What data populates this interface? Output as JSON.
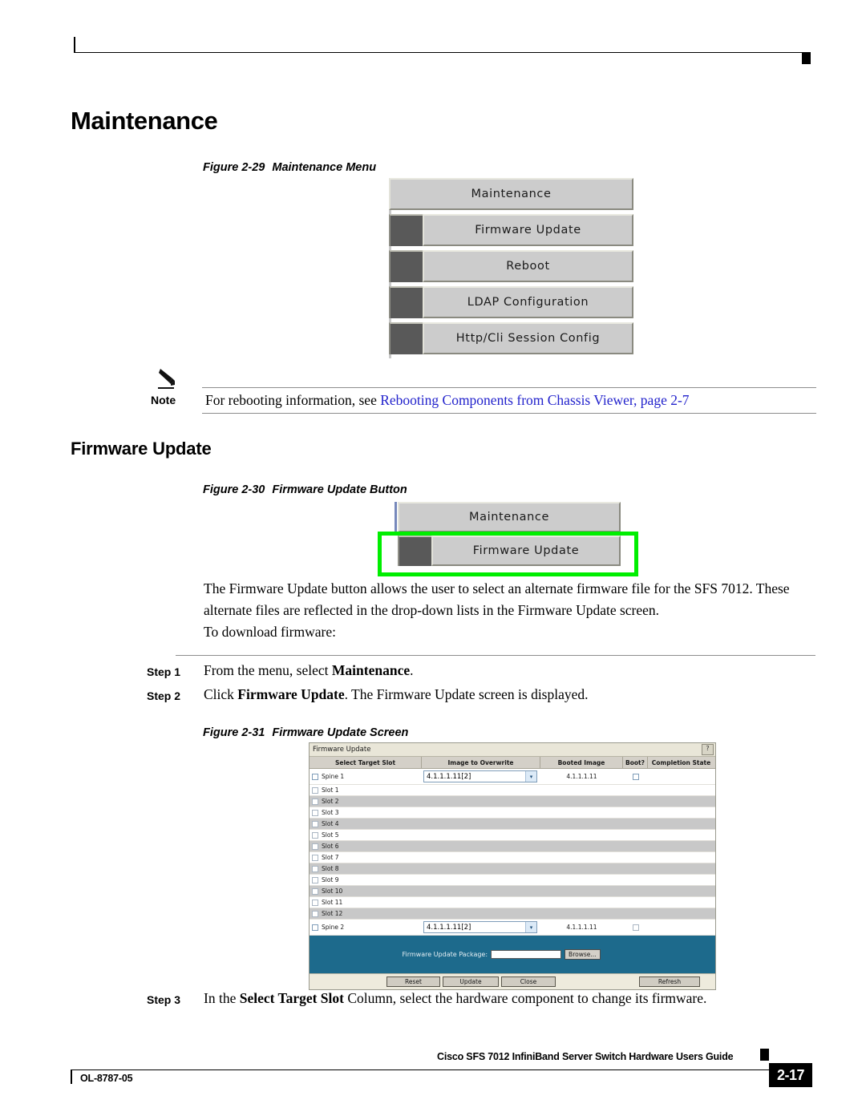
{
  "page": {
    "heading_maintenance": "Maintenance",
    "heading_firmware_update": "Firmware Update"
  },
  "figure_229": {
    "caption_number": "Figure 2-29",
    "caption_title": "Maintenance Menu",
    "menu_items": [
      {
        "label": "Maintenance",
        "has_gutter": false
      },
      {
        "label": "Firmware Update",
        "has_gutter": true
      },
      {
        "label": "Reboot",
        "has_gutter": true
      },
      {
        "label": "LDAP Configuration",
        "has_gutter": true
      },
      {
        "label": "Http/Cli Session Config",
        "has_gutter": true
      }
    ]
  },
  "note": {
    "label": "Note",
    "text_before": "For rebooting information, see ",
    "link_text": "Rebooting Components from Chassis Viewer, page 2-7",
    "link_color": "#2222cc"
  },
  "figure_230": {
    "caption_number": "Figure 2-30",
    "caption_title": "Firmware Update Button",
    "menu_items": [
      {
        "label": "Maintenance",
        "has_gutter": false
      },
      {
        "label": "Firmware Update",
        "has_gutter": true
      }
    ],
    "highlight_color": "#00ee00"
  },
  "body": {
    "paragraph_1": "The Firmware Update button allows the user to select an alternate firmware file for the SFS 7012. These alternate files are reflected in the drop-down lists in the Firmware Update screen.",
    "paragraph_2": "To download firmware:"
  },
  "steps": [
    {
      "label": "Step 1",
      "text_plain_1": "From the menu, select ",
      "text_bold": "Maintenance",
      "text_plain_2": "."
    },
    {
      "label": "Step 2",
      "text_plain_1": "Click ",
      "text_bold": "Firmware Update",
      "text_plain_2": ". The Firmware Update screen is displayed."
    },
    {
      "label": "Step 3",
      "text_plain_1": "In the ",
      "text_bold": "Select Target Slot",
      "text_plain_2": " Column, select the hardware component to change its firmware."
    }
  ],
  "figure_231": {
    "caption_number": "Figure 2-31",
    "caption_title": "Firmware Update Screen",
    "window_title": "Firmware Update",
    "help_button": "?",
    "columns": [
      "Select Target Slot",
      "Image to Overwrite",
      "Booted Image",
      "Boot?",
      "Completion State"
    ],
    "rows": [
      {
        "slot": "Spine 1",
        "image_to_overwrite": "4.1.1.1.11[2]",
        "booted_image": "4.1.1.1.11",
        "boot": false,
        "completion_state": "",
        "has_controls": true
      },
      {
        "slot": "Slot 1",
        "image_to_overwrite": "",
        "booted_image": "",
        "boot": null,
        "completion_state": "",
        "has_controls": false
      },
      {
        "slot": "Slot 2",
        "image_to_overwrite": "",
        "booted_image": "",
        "boot": null,
        "completion_state": "",
        "has_controls": false
      },
      {
        "slot": "Slot 3",
        "image_to_overwrite": "",
        "booted_image": "",
        "boot": null,
        "completion_state": "",
        "has_controls": false
      },
      {
        "slot": "Slot 4",
        "image_to_overwrite": "",
        "booted_image": "",
        "boot": null,
        "completion_state": "",
        "has_controls": false
      },
      {
        "slot": "Slot 5",
        "image_to_overwrite": "",
        "booted_image": "",
        "boot": null,
        "completion_state": "",
        "has_controls": false
      },
      {
        "slot": "Slot 6",
        "image_to_overwrite": "",
        "booted_image": "",
        "boot": null,
        "completion_state": "",
        "has_controls": false
      },
      {
        "slot": "Slot 7",
        "image_to_overwrite": "",
        "booted_image": "",
        "boot": null,
        "completion_state": "",
        "has_controls": false
      },
      {
        "slot": "Slot 8",
        "image_to_overwrite": "",
        "booted_image": "",
        "boot": null,
        "completion_state": "",
        "has_controls": false
      },
      {
        "slot": "Slot 9",
        "image_to_overwrite": "",
        "booted_image": "",
        "boot": null,
        "completion_state": "",
        "has_controls": false
      },
      {
        "slot": "Slot 10",
        "image_to_overwrite": "",
        "booted_image": "",
        "boot": null,
        "completion_state": "",
        "has_controls": false
      },
      {
        "slot": "Slot 11",
        "image_to_overwrite": "",
        "booted_image": "",
        "boot": null,
        "completion_state": "",
        "has_controls": false
      },
      {
        "slot": "Slot 12",
        "image_to_overwrite": "",
        "booted_image": "",
        "boot": null,
        "completion_state": "",
        "has_controls": false
      },
      {
        "slot": "Spine 2",
        "image_to_overwrite": "4.1.1.1.11[2]",
        "booted_image": "4.1.1.1.11",
        "boot": false,
        "completion_state": "",
        "has_controls": true
      }
    ],
    "upload": {
      "label": "Firmware Update Package:",
      "value": "",
      "browse_label": "Browse...",
      "panel_color": "#1d6a8c"
    },
    "buttons": {
      "reset": "Reset",
      "update": "Update",
      "close": "Close",
      "refresh": "Refresh"
    }
  },
  "footer": {
    "guide_title": "Cisco SFS 7012 InfiniBand Server Switch Hardware Users Guide",
    "doc_id": "OL-8787-05",
    "page_number": "2-17"
  }
}
